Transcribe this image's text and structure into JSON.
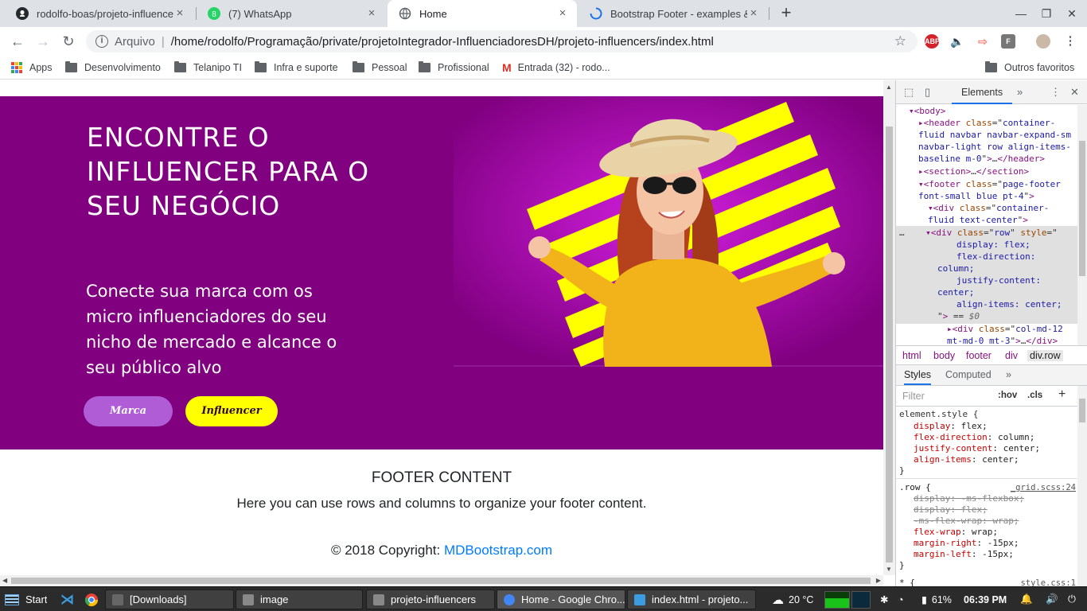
{
  "tabs": [
    {
      "title": "rodolfo-boas/projeto-influencer",
      "icon": "github-icon"
    },
    {
      "title": "(7) WhatsApp",
      "icon": "whatsapp-icon"
    },
    {
      "title": "Home",
      "icon": "globe-icon"
    },
    {
      "title": "Bootstrap Footer - examples &",
      "icon": "loading-icon"
    }
  ],
  "address": {
    "scheme": "Arquivo",
    "url": "/home/rodolfo/Programação/private/projetoIntegrador-InfluenciadoresDH/projeto-influencers/index.html"
  },
  "extensions": [
    "ABP",
    "F"
  ],
  "bookmarks": {
    "items": [
      "Apps",
      "Desenvolvimento",
      "Telanipo TI",
      "Infra e suporte",
      "Pessoal",
      "Profissional",
      "Entrada (32) - rodo..."
    ],
    "other": "Outros favoritos"
  },
  "page": {
    "hero_title": "ENCONTRE O INFLUENCER PARA O SEU NEGÓCIO",
    "hero_text": "Conecte sua marca com os micro influenciadores do seu nicho de mercado e alcance o seu público alvo",
    "btn_marca": "Marca",
    "btn_influencer": "Influencer",
    "footer_title": "FOOTER CONTENT",
    "footer_text": "Here you can use rows and columns to organize your footer content.",
    "copyright_prefix": "© 2018 Copyright: ",
    "copyright_link": "MDBootstrap.com",
    "colors": {
      "hero_bg": "#800080",
      "accent_yellow": "#ffff00",
      "button_purple": "#b05cd6",
      "link": "#007bff"
    }
  },
  "devtools": {
    "tab": "Elements",
    "breadcrumbs": [
      "html",
      "body",
      "footer",
      "div",
      "div.row"
    ],
    "styles_tabs": [
      "Styles",
      "Computed"
    ],
    "filter_placeholder": "Filter",
    "hov": ":hov",
    "cls": ".cls",
    "row_source": "_grid.scss:24",
    "style_source": "style.css:1"
  },
  "taskbar": {
    "start": "Start",
    "items": [
      "[Downloads]",
      "image",
      "projeto-influencers",
      "Home - Google Chro...",
      "index.html - projeto..."
    ],
    "temperature": "20 °C",
    "battery": "61%",
    "time": "06:39 PM"
  }
}
